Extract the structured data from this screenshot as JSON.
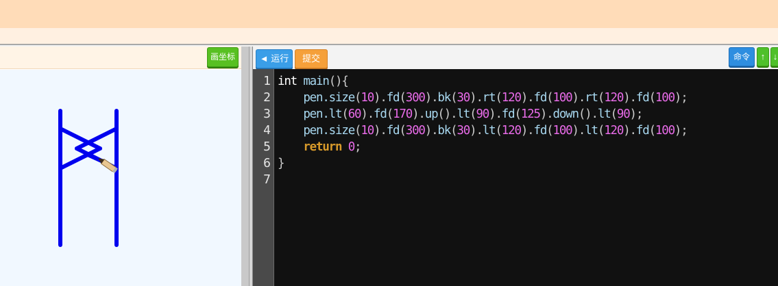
{
  "left_toolbar": {
    "coord_button": "画坐标"
  },
  "right_toolbar": {
    "run_button": "◄ 运行",
    "submit_button": "提交",
    "command_button": "命令",
    "up_button": "↑",
    "down_button": "↓"
  },
  "editor": {
    "line_numbers": [
      "1",
      "2",
      "3",
      "4",
      "5",
      "6",
      "7"
    ],
    "lines": [
      [
        {
          "t": "kw",
          "v": "int "
        },
        {
          "t": "fn",
          "v": "main"
        },
        {
          "t": "punc",
          "v": "(){"
        }
      ],
      [
        {
          "t": "fn",
          "v": "    pen.size"
        },
        {
          "t": "punc",
          "v": "("
        },
        {
          "t": "num",
          "v": "10"
        },
        {
          "t": "punc",
          "v": ")."
        },
        {
          "t": "fn",
          "v": "fd"
        },
        {
          "t": "punc",
          "v": "("
        },
        {
          "t": "num",
          "v": "300"
        },
        {
          "t": "punc",
          "v": ")."
        },
        {
          "t": "fn",
          "v": "bk"
        },
        {
          "t": "punc",
          "v": "("
        },
        {
          "t": "num",
          "v": "30"
        },
        {
          "t": "punc",
          "v": ")."
        },
        {
          "t": "fn",
          "v": "rt"
        },
        {
          "t": "punc",
          "v": "("
        },
        {
          "t": "num",
          "v": "120"
        },
        {
          "t": "punc",
          "v": ")."
        },
        {
          "t": "fn",
          "v": "fd"
        },
        {
          "t": "punc",
          "v": "("
        },
        {
          "t": "num",
          "v": "100"
        },
        {
          "t": "punc",
          "v": ")."
        },
        {
          "t": "fn",
          "v": "rt"
        },
        {
          "t": "punc",
          "v": "("
        },
        {
          "t": "num",
          "v": "120"
        },
        {
          "t": "punc",
          "v": ")."
        },
        {
          "t": "fn",
          "v": "fd"
        },
        {
          "t": "punc",
          "v": "("
        },
        {
          "t": "num",
          "v": "100"
        },
        {
          "t": "punc",
          "v": ");"
        }
      ],
      [
        {
          "t": "fn",
          "v": "    pen.lt"
        },
        {
          "t": "punc",
          "v": "("
        },
        {
          "t": "num",
          "v": "60"
        },
        {
          "t": "punc",
          "v": ")."
        },
        {
          "t": "fn",
          "v": "fd"
        },
        {
          "t": "punc",
          "v": "("
        },
        {
          "t": "num",
          "v": "170"
        },
        {
          "t": "punc",
          "v": ")."
        },
        {
          "t": "fn",
          "v": "up"
        },
        {
          "t": "punc",
          "v": "()."
        },
        {
          "t": "fn",
          "v": "lt"
        },
        {
          "t": "punc",
          "v": "("
        },
        {
          "t": "num",
          "v": "90"
        },
        {
          "t": "punc",
          "v": ")."
        },
        {
          "t": "fn",
          "v": "fd"
        },
        {
          "t": "punc",
          "v": "("
        },
        {
          "t": "num",
          "v": "125"
        },
        {
          "t": "punc",
          "v": ")."
        },
        {
          "t": "fn",
          "v": "down"
        },
        {
          "t": "punc",
          "v": "()."
        },
        {
          "t": "fn",
          "v": "lt"
        },
        {
          "t": "punc",
          "v": "("
        },
        {
          "t": "num",
          "v": "90"
        },
        {
          "t": "punc",
          "v": ");"
        }
      ],
      [
        {
          "t": "fn",
          "v": "    pen.size"
        },
        {
          "t": "punc",
          "v": "("
        },
        {
          "t": "num",
          "v": "10"
        },
        {
          "t": "punc",
          "v": ")."
        },
        {
          "t": "fn",
          "v": "fd"
        },
        {
          "t": "punc",
          "v": "("
        },
        {
          "t": "num",
          "v": "300"
        },
        {
          "t": "punc",
          "v": ")."
        },
        {
          "t": "fn",
          "v": "bk"
        },
        {
          "t": "punc",
          "v": "("
        },
        {
          "t": "num",
          "v": "30"
        },
        {
          "t": "punc",
          "v": ")."
        },
        {
          "t": "fn",
          "v": "lt"
        },
        {
          "t": "punc",
          "v": "("
        },
        {
          "t": "num",
          "v": "120"
        },
        {
          "t": "punc",
          "v": ")."
        },
        {
          "t": "fn",
          "v": "fd"
        },
        {
          "t": "punc",
          "v": "("
        },
        {
          "t": "num",
          "v": "100"
        },
        {
          "t": "punc",
          "v": ")."
        },
        {
          "t": "fn",
          "v": "lt"
        },
        {
          "t": "punc",
          "v": "("
        },
        {
          "t": "num",
          "v": "120"
        },
        {
          "t": "punc",
          "v": ")."
        },
        {
          "t": "fn",
          "v": "fd"
        },
        {
          "t": "punc",
          "v": "("
        },
        {
          "t": "num",
          "v": "100"
        },
        {
          "t": "punc",
          "v": ");"
        }
      ],
      [
        {
          "t": "ret",
          "v": "    return "
        },
        {
          "t": "num",
          "v": "0"
        },
        {
          "t": "punc",
          "v": ";"
        }
      ],
      [
        {
          "t": "punc",
          "v": "}"
        }
      ],
      []
    ]
  },
  "colors": {
    "stroke": "#0000ee",
    "run_button": "#3a9ee8",
    "submit_button": "#f5a03a",
    "coord_button": "#58c022",
    "command_button": "#2e8ee0"
  }
}
